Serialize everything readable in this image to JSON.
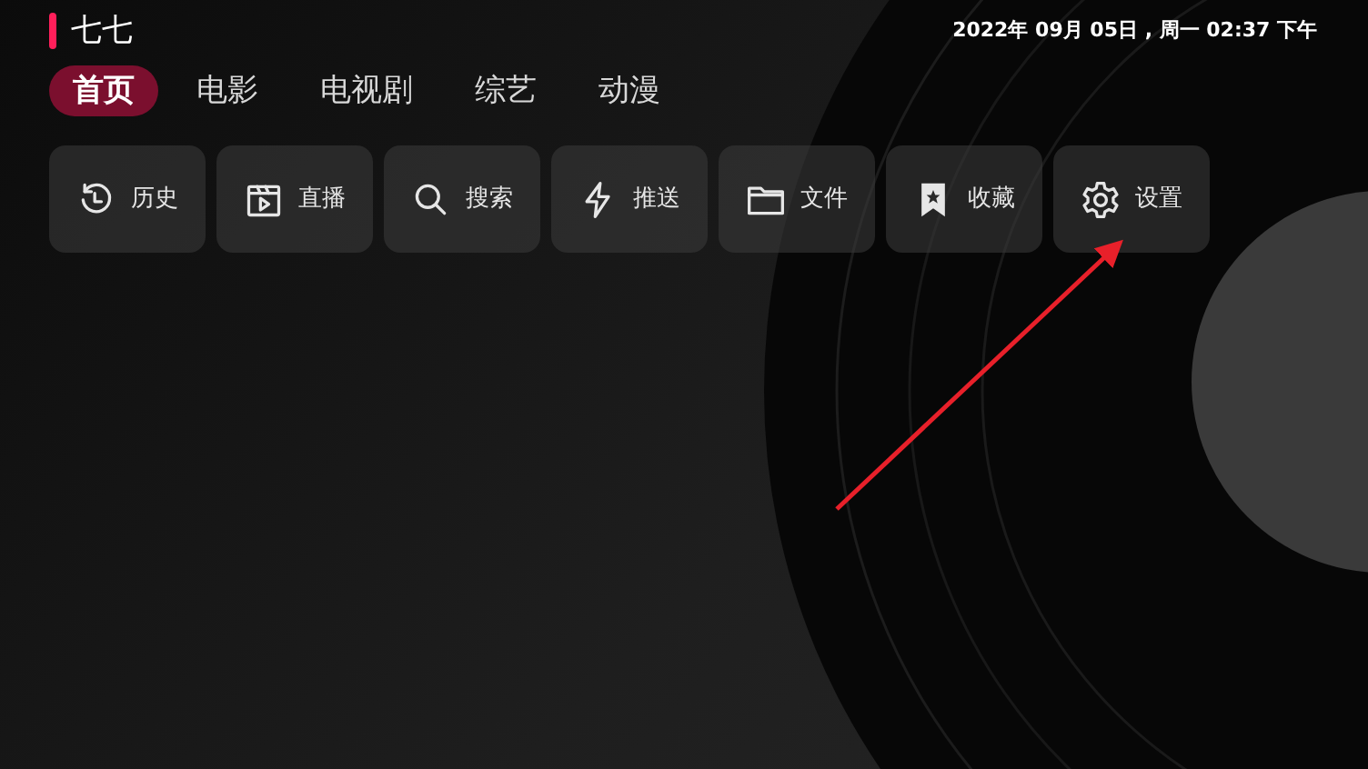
{
  "app": {
    "title": "七七"
  },
  "datetime": "2022年 09月 05日 , 周一 02:37 下午",
  "tabs": [
    {
      "label": "首页",
      "selected": true
    },
    {
      "label": "电影",
      "selected": false
    },
    {
      "label": "电视剧",
      "selected": false
    },
    {
      "label": "综艺",
      "selected": false
    },
    {
      "label": "动漫",
      "selected": false
    }
  ],
  "shortcuts": [
    {
      "label": "历史",
      "kind": "history"
    },
    {
      "label": "直播",
      "kind": "live"
    },
    {
      "label": "搜索",
      "kind": "search"
    },
    {
      "label": "推送",
      "kind": "push"
    },
    {
      "label": "文件",
      "kind": "file"
    },
    {
      "label": "收藏",
      "kind": "favorite"
    },
    {
      "label": "设置",
      "kind": "settings"
    }
  ]
}
